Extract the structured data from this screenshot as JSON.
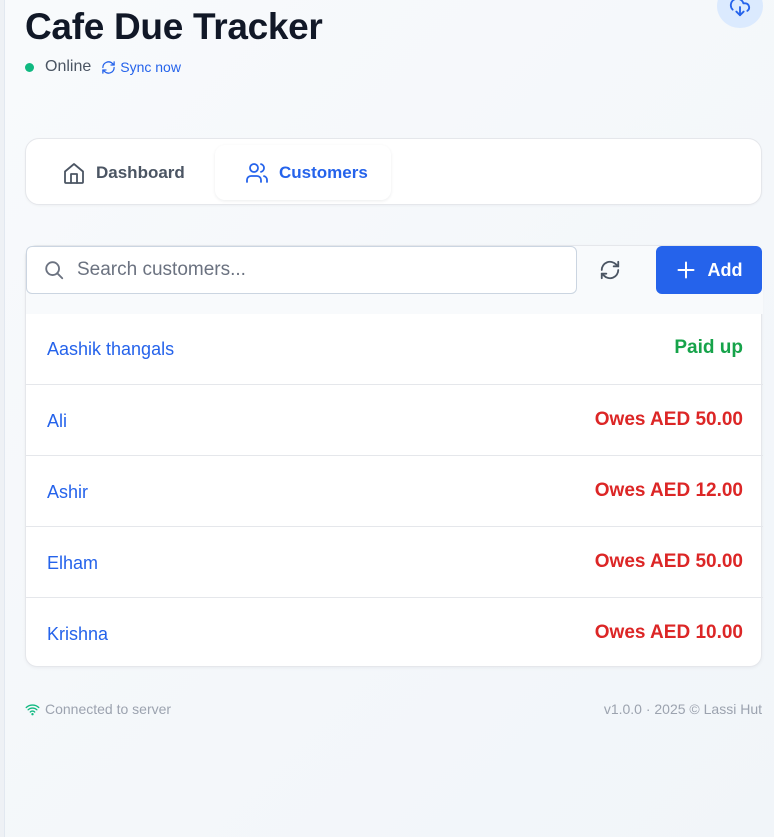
{
  "app": {
    "title": "Cafe Due Tracker",
    "status_text": "Online",
    "sync_label": "Sync now"
  },
  "icons": {
    "cloud": "cloud-download-icon",
    "sync": "refresh-icon",
    "home": "home-icon",
    "users": "users-icon",
    "search": "search-icon",
    "plus": "plus-icon",
    "wifi": "wifi-icon"
  },
  "tabs": [
    {
      "label": "Dashboard",
      "active": false
    },
    {
      "label": "Customers",
      "active": true
    }
  ],
  "search": {
    "placeholder": "Search customers...",
    "value": ""
  },
  "toolbar": {
    "add_label": "Add"
  },
  "customers": [
    {
      "name": "Aashik thangals",
      "status": "Paid up",
      "state": "paid"
    },
    {
      "name": "Ali",
      "status": "Owes AED 50.00",
      "state": "owes"
    },
    {
      "name": "Ashir",
      "status": "Owes AED 12.00",
      "state": "owes"
    },
    {
      "name": "Elham",
      "status": "Owes AED 50.00",
      "state": "owes"
    },
    {
      "name": "Krishna",
      "status": "Owes AED 10.00",
      "state": "owes"
    }
  ],
  "footer": {
    "connection": "Connected to server",
    "version": "v1.0.0 · 2025 © Lassi Hut"
  },
  "colors": {
    "accent": "#2563eb",
    "online": "#10b981",
    "paid": "#16a34a",
    "owes": "#dc2626"
  }
}
